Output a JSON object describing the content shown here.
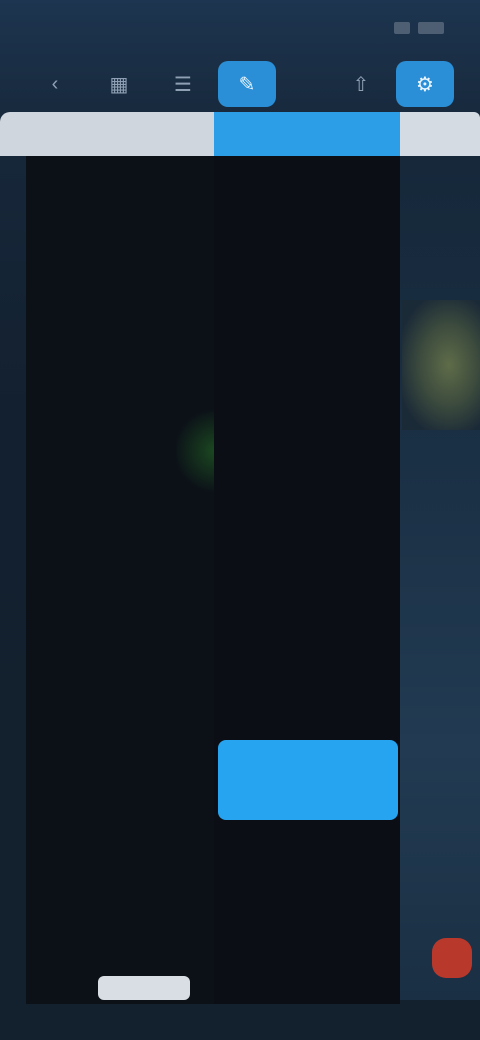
{
  "status_bar": {
    "time": "",
    "right_text": ""
  },
  "toolbar": {
    "buttons": [
      {
        "icon": "back-icon",
        "active": false
      },
      {
        "icon": "grid-icon",
        "active": false
      },
      {
        "icon": "layers-icon",
        "active": false
      },
      {
        "icon": "edit-icon",
        "active": true
      },
      {
        "icon": "share-icon",
        "active": false
      },
      {
        "icon": "settings-icon",
        "active": true
      }
    ]
  },
  "menu": {
    "left_header": "",
    "right_header": "",
    "categories": [
      "",
      "",
      "",
      "",
      "",
      "",
      "",
      "",
      "",
      "",
      "",
      "",
      "",
      "",
      "",
      "",
      "",
      "",
      "",
      "",
      "",
      ""
    ],
    "submenu": [
      "",
      "",
      "",
      "",
      "",
      "",
      "",
      "",
      "",
      "",
      "",
      "",
      ""
    ],
    "primary_action": "",
    "submenu_lower": [
      "",
      "",
      "",
      ""
    ]
  },
  "colors": {
    "accent": "#2c9ee8",
    "panel": "#0c1118",
    "record": "#b8382c"
  }
}
